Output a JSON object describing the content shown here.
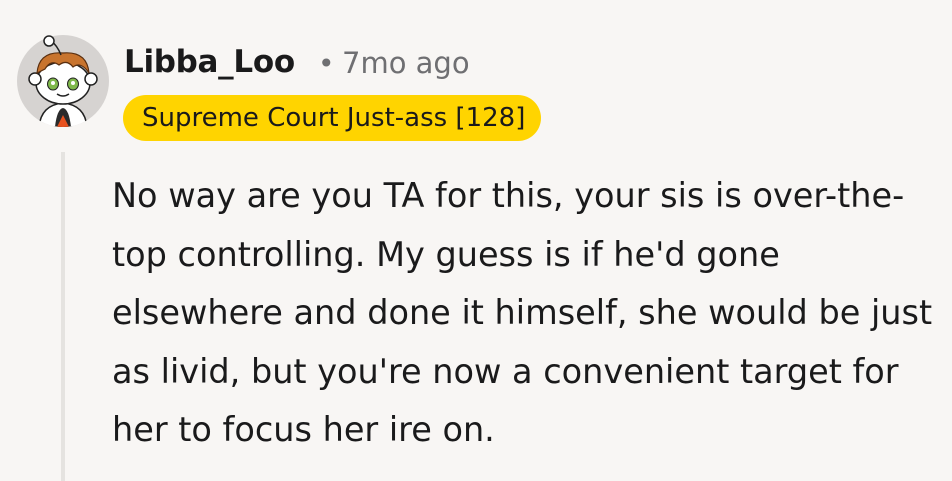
{
  "comment": {
    "author": "Libba_Loo",
    "separator": "•",
    "age": "7mo ago",
    "flair": "Supreme Court Just-ass [128]",
    "flair_color": "#ffd400",
    "avatar_icon": "snoo-avatar-icon",
    "body": "No way are you TA for this, your sis is over-the-top controlling. My guess is if he'd gone elsewhere and done it himself, she would be just as livid, but you're now a convenient target for her to focus her ire on."
  }
}
